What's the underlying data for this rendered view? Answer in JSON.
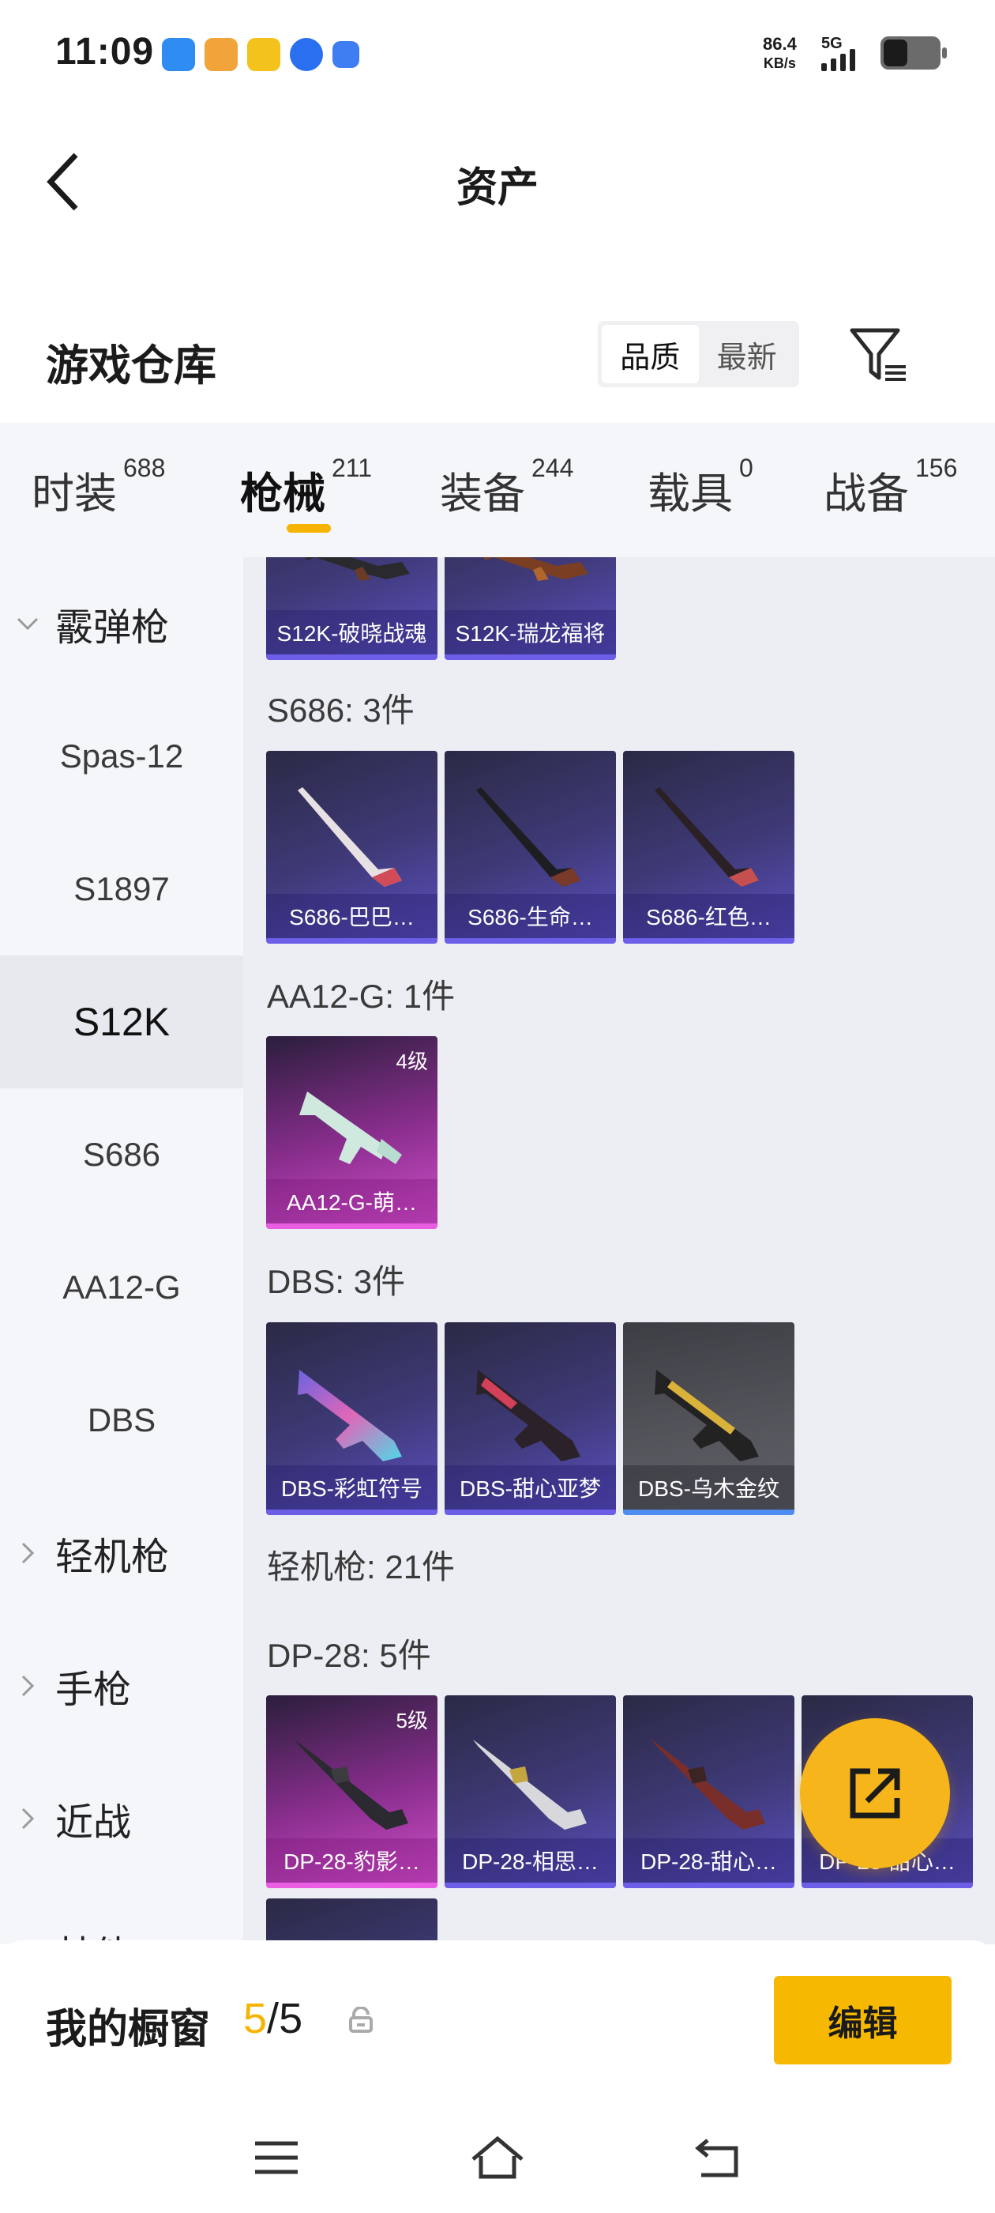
{
  "status_bar": {
    "time": "11:09",
    "speed_value": "86.4",
    "speed_unit": "KB/s",
    "network": "5G",
    "app_icons": [
      "browser-icon",
      "game-app-icon",
      "bear-app-icon",
      "du-app-icon",
      "chat-app-icon"
    ],
    "battery_level": 0.4
  },
  "header": {
    "title": "资产"
  },
  "section": {
    "title": "游戏仓库",
    "sort_options": [
      "品质",
      "最新"
    ],
    "selected_sort": "品质"
  },
  "tabs": [
    {
      "label": "时装",
      "count": "688"
    },
    {
      "label": "枪械",
      "count": "211"
    },
    {
      "label": "装备",
      "count": "244"
    },
    {
      "label": "载具",
      "count": "0"
    },
    {
      "label": "战备",
      "count": "156"
    }
  ],
  "active_tab": "枪械",
  "sidebar": {
    "groups": [
      {
        "label": "霰弹枪",
        "expanded": true
      },
      {
        "label": "轻机枪",
        "expanded": false
      },
      {
        "label": "手枪",
        "expanded": false
      },
      {
        "label": "近战",
        "expanded": false
      },
      {
        "label": "其他",
        "expanded": false
      }
    ],
    "items": [
      "Spas-12",
      "S1897",
      "S12K",
      "S686",
      "AA12-G",
      "DBS"
    ],
    "selected_item": "S12K"
  },
  "content": {
    "groups": [
      {
        "header": "",
        "items": [
          {
            "name": "S12K-破晓战魂",
            "rarity": "purple",
            "level": ""
          },
          {
            "name": "S12K-瑞龙福将",
            "rarity": "purple",
            "level": ""
          }
        ]
      },
      {
        "header": "S686: 3件",
        "items": [
          {
            "name": "S686-巴巴…",
            "rarity": "purple",
            "level": ""
          },
          {
            "name": "S686-生命…",
            "rarity": "purple",
            "level": ""
          },
          {
            "name": "S686-红色…",
            "rarity": "purple",
            "level": ""
          }
        ]
      },
      {
        "header": "AA12-G: 1件",
        "items": [
          {
            "name": "AA12-G-萌…",
            "rarity": "pink",
            "level": "4级"
          }
        ]
      },
      {
        "header": "DBS: 3件",
        "items": [
          {
            "name": "DBS-彩虹符号",
            "rarity": "purple",
            "level": ""
          },
          {
            "name": "DBS-甜心亚梦",
            "rarity": "purple",
            "level": ""
          },
          {
            "name": "DBS-乌木金纹",
            "rarity": "gray",
            "level": ""
          }
        ]
      },
      {
        "header": "轻机枪: 21件",
        "items": []
      },
      {
        "header": "DP-28: 5件",
        "items": [
          {
            "name": "DP-28-豹影…",
            "rarity": "pink",
            "level": "5级"
          },
          {
            "name": "DP-28-相思…",
            "rarity": "purple",
            "level": ""
          },
          {
            "name": "DP-28-甜心…",
            "rarity": "purple",
            "level": ""
          },
          {
            "name": "DP-28-甜心…",
            "rarity": "purple",
            "level": ""
          },
          {
            "name": "",
            "rarity": "purple",
            "level": ""
          }
        ]
      }
    ]
  },
  "showcase": {
    "title": "我的橱窗",
    "current": "5",
    "separator": "/",
    "total": "5",
    "edit_label": "编辑"
  },
  "colors": {
    "accent": "#f6b800",
    "purple_rarity": "#6d5ee8",
    "pink_rarity": "#ea5ee4",
    "gray_rarity_bar": "#4f8cf0"
  }
}
